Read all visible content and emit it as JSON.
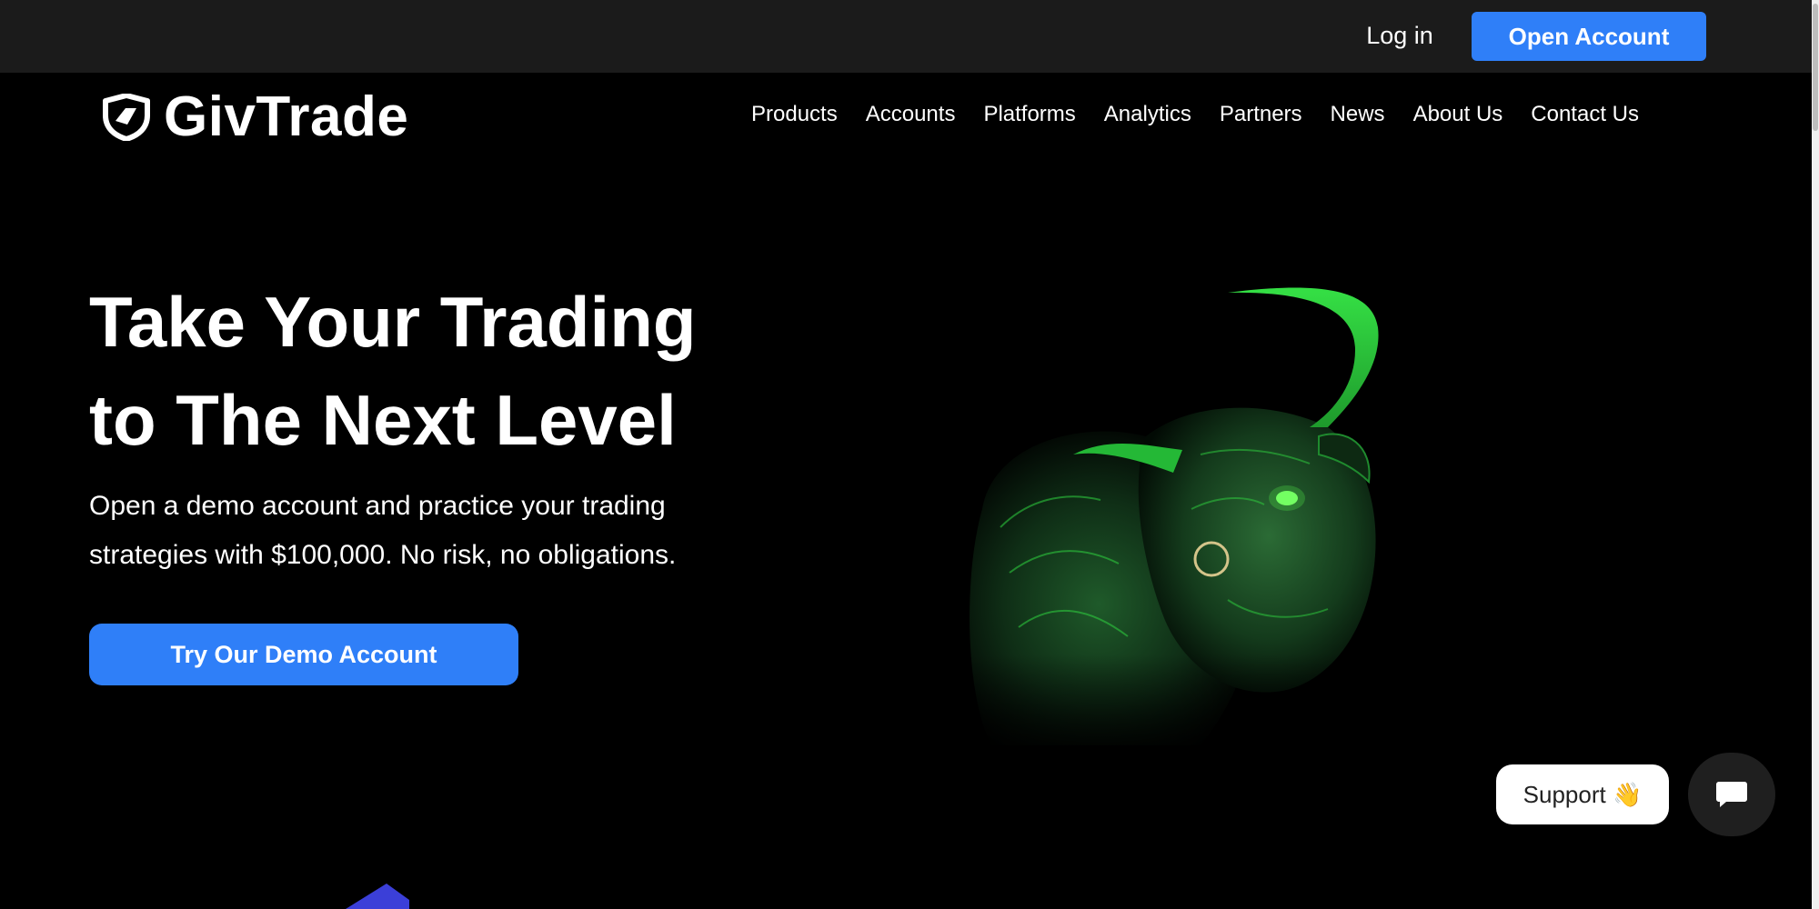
{
  "topbar": {
    "login_label": "Log in",
    "open_account_label": "Open Account"
  },
  "brand": {
    "name": "GivTrade",
    "accent": "#2f7ff8"
  },
  "nav": {
    "items": [
      {
        "label": "Products"
      },
      {
        "label": "Accounts"
      },
      {
        "label": "Platforms"
      },
      {
        "label": "Analytics"
      },
      {
        "label": "Partners"
      },
      {
        "label": "News"
      },
      {
        "label": "About Us"
      },
      {
        "label": "Contact Us"
      }
    ]
  },
  "hero": {
    "title_line1": "Take Your Trading",
    "title_line2": "to The Next Level",
    "subtitle_line1": "Open a demo account and practice your trading",
    "subtitle_line2": "strategies with $100,000. No risk, no obligations.",
    "cta_label": "Try Our Demo Account"
  },
  "support": {
    "label": "Support 👋",
    "chat_icon": "chat-bubble-icon"
  }
}
